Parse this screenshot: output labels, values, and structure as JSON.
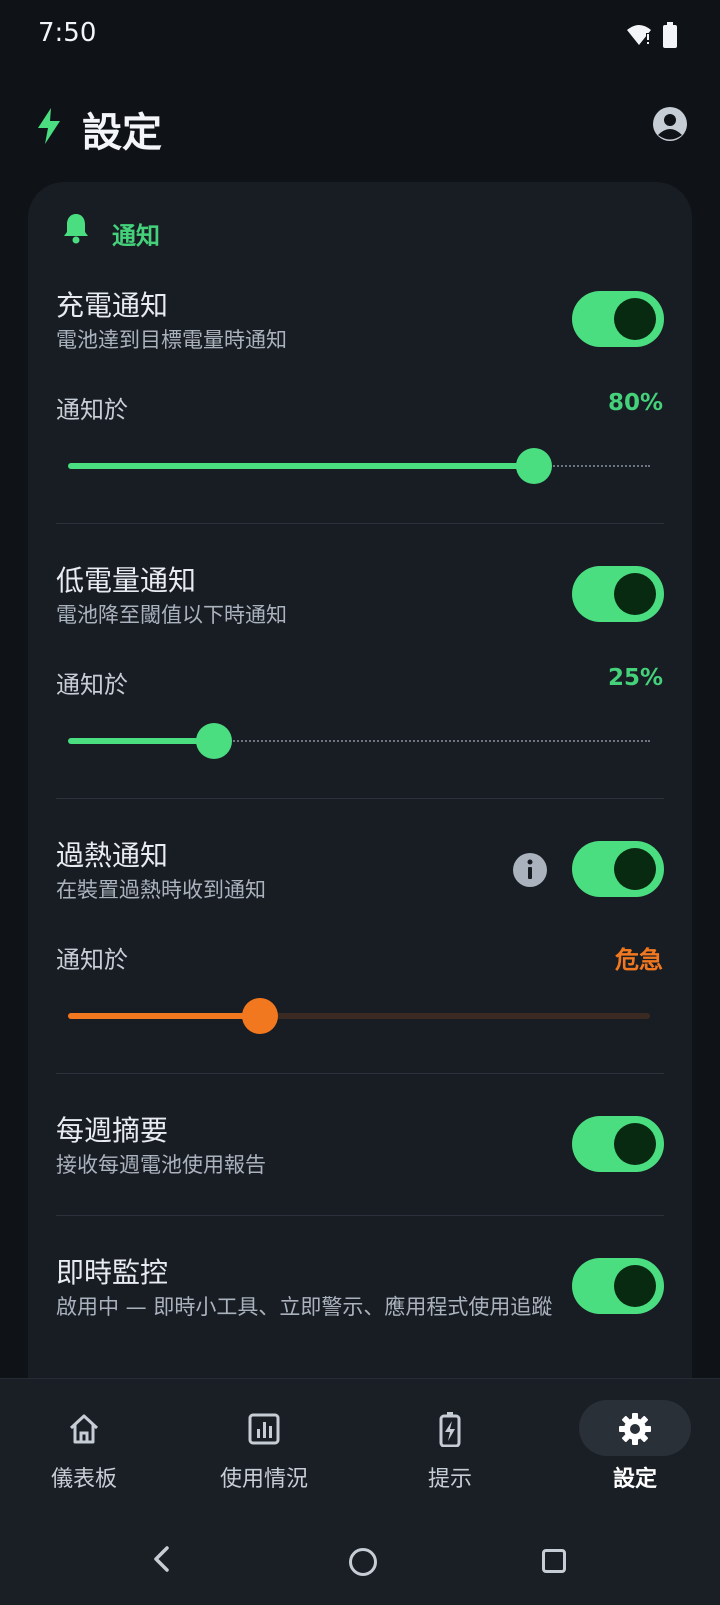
{
  "status_bar": {
    "time": "7:50"
  },
  "header": {
    "title": "設定"
  },
  "section": {
    "title": "通知"
  },
  "items": [
    {
      "title": "充電通知",
      "subtitle": "電池達到目標電量時通知",
      "toggle_on": true,
      "threshold_label": "通知於",
      "threshold_value": "80%",
      "slider_fraction": 0.8
    },
    {
      "title": "低電量通知",
      "subtitle": "電池降至閾值以下時通知",
      "toggle_on": true,
      "threshold_label": "通知於",
      "threshold_value": "25%",
      "slider_fraction": 0.25
    },
    {
      "title": "過熱通知",
      "subtitle": "在裝置過熱時收到通知",
      "toggle_on": true,
      "threshold_label": "通知於",
      "threshold_value": "危急",
      "slider_fraction": 0.33
    },
    {
      "title": "每週摘要",
      "subtitle": "接收每週電池使用報告",
      "toggle_on": true
    },
    {
      "title": "即時監控",
      "subtitle": "啟用中 — 即時小工具、立即警示、應用程式使用追蹤",
      "toggle_on": true
    }
  ],
  "bottom_nav": [
    {
      "label": "儀表板",
      "icon": "home-icon",
      "active": false
    },
    {
      "label": "使用情況",
      "icon": "chart-icon",
      "active": false
    },
    {
      "label": "提示",
      "icon": "battery-bolt-icon",
      "active": false
    },
    {
      "label": "設定",
      "icon": "gear-icon",
      "active": true
    }
  ],
  "colors": {
    "accent": "#4ade80",
    "warning": "#f2781f",
    "background": "#0f1317",
    "card": "#181d24"
  }
}
